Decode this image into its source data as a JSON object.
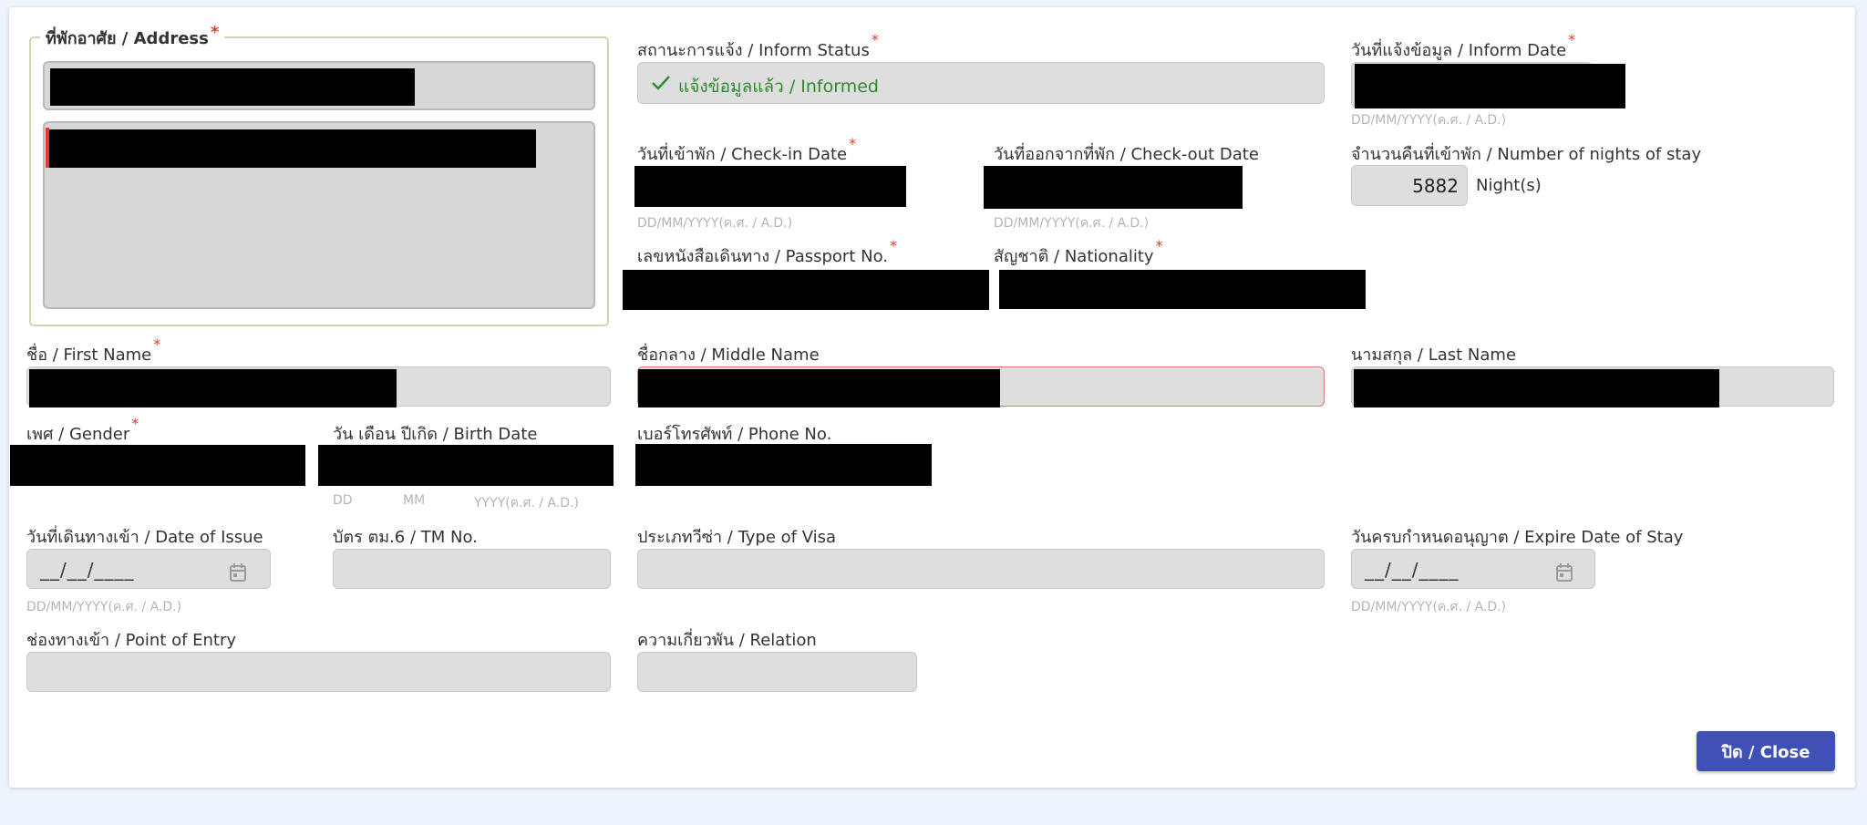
{
  "address": {
    "legend": "ที่พักอาศัย / Address",
    "required": "*"
  },
  "inform_status": {
    "label": "สถานะการแจ้ง / Inform Status",
    "required": "*",
    "value": "แจ้งข้อมูลแล้ว / Informed",
    "icon": "check-icon",
    "color": "#2e8b2e"
  },
  "inform_date": {
    "label": "วันที่แจ้งข้อมูล / Inform Date",
    "required": "*",
    "hint": "DD/MM/YYYY(ค.ศ. / A.D.)"
  },
  "checkin": {
    "label": "วันที่เข้าพัก / Check-in Date",
    "required": "*",
    "hint": "DD/MM/YYYY(ค.ศ. / A.D.)"
  },
  "checkout": {
    "label": "วันที่ออกจากที่พัก / Check-out Date",
    "hint": "DD/MM/YYYY(ค.ศ. / A.D.)"
  },
  "nights": {
    "label": "จำนวนคืนที่เข้าพัก / Number of nights of stay",
    "value": "5882",
    "unit": "Night(s)"
  },
  "passport": {
    "label": "เลขหนังสือเดินทาง / Passport No.",
    "required": "*"
  },
  "nationality": {
    "label": "สัญชาติ / Nationality",
    "required": "*"
  },
  "first_name": {
    "label": "ชื่อ / First Name",
    "required": "*"
  },
  "middle_name": {
    "label": "ชื่อกลาง / Middle Name"
  },
  "last_name": {
    "label": "นามสกุล / Last Name"
  },
  "gender": {
    "label": "เพศ / Gender",
    "required": "*"
  },
  "birth_date": {
    "label": "วัน เดือน ปีเกิด / Birth Date",
    "hint_dd": "DD",
    "hint_mm": "MM",
    "hint_yyyy": "YYYY(ค.ศ. / A.D.)"
  },
  "phone": {
    "label": "เบอร์โทรศัพท์ / Phone No."
  },
  "date_of_issue": {
    "label": "วันที่เดินทางเข้า / Date of Issue",
    "value": "__/__/____",
    "hint": "DD/MM/YYYY(ค.ศ. / A.D.)",
    "icon": "calendar-icon"
  },
  "tm_no": {
    "label": "บัตร ตม.6 / TM No."
  },
  "visa_type": {
    "label": "ประเภทวีซ่า / Type of Visa"
  },
  "expire_date": {
    "label": "วันครบกำหนดอนุญาต / Expire Date of Stay",
    "value": "__/__/____",
    "hint": "DD/MM/YYYY(ค.ศ. / A.D.)",
    "icon": "calendar-icon"
  },
  "point_of_entry": {
    "label": "ช่องทางเข้า / Point of Entry"
  },
  "relation": {
    "label": "ความเกี่ยวพัน / Relation"
  },
  "close_button": {
    "label": "ปิด / Close",
    "color": "#3f51b5"
  }
}
